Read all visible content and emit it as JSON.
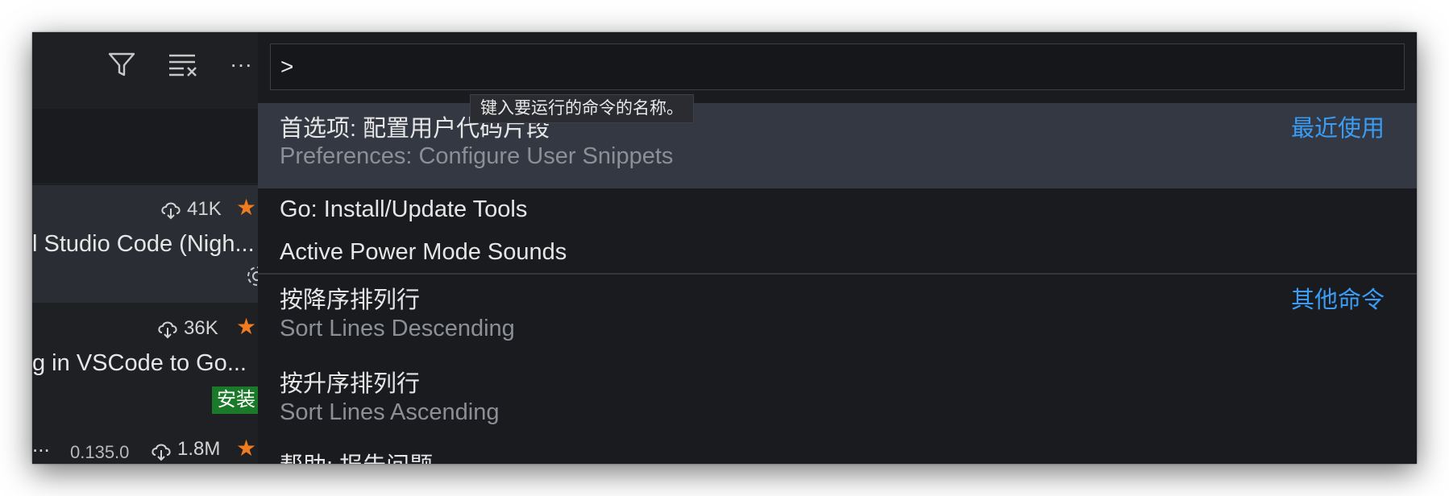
{
  "toolbar": {
    "filter_icon": "filter-icon",
    "clear_icon": "clear-list-icon",
    "more_label": "···"
  },
  "extensions": [
    {
      "downloads": "41K",
      "name": "l Studio Code (Nigh..."
    },
    {
      "downloads": "36K",
      "name": "g in VSCode to Go...",
      "install_label": "安装"
    },
    {
      "name_prefix": "...",
      "version": "0.135.0",
      "downloads": "1.8M"
    }
  ],
  "palette": {
    "input_value": ">",
    "tooltip": "键入要运行的命令的名称。",
    "items": [
      {
        "label": "首选项: 配置用户代码片段",
        "detail": "Preferences: Configure User Snippets",
        "category": "最近使用"
      },
      {
        "label": "Go: Install/Update Tools"
      },
      {
        "label": "Active Power Mode Sounds"
      },
      {
        "label": "按降序排列行",
        "detail": "Sort Lines Descending",
        "category": "其他命令"
      },
      {
        "label": "按升序排列行",
        "detail": "Sort Lines Ascending"
      },
      {
        "label": "帮助: 报告问题"
      }
    ]
  },
  "colors": {
    "accent": "#3a9cf5",
    "star": "#f07c1f",
    "install_bg": "#1b7a2a",
    "selected_row": "#343843"
  }
}
